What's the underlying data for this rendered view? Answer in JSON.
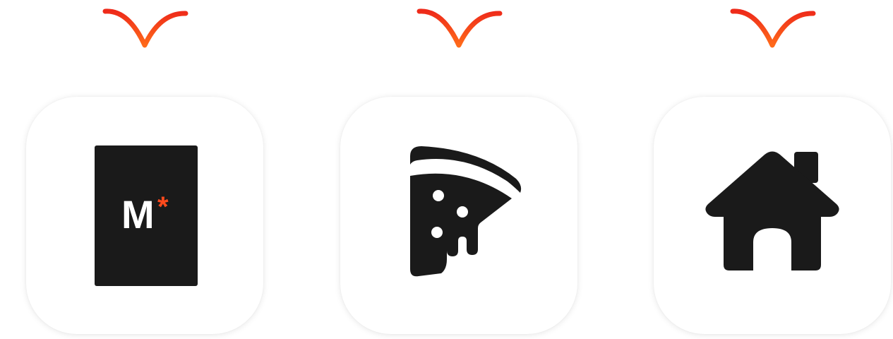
{
  "colors": {
    "accent": "#ff4a1c",
    "icon_dark": "#1a1a1a",
    "card_bg": "#ffffff"
  },
  "items": [
    {
      "id": "menu",
      "icon": "menu-book-icon",
      "logo_letter": "M",
      "logo_mark": "*"
    },
    {
      "id": "food",
      "icon": "pizza-slice-icon"
    },
    {
      "id": "home",
      "icon": "house-icon"
    }
  ]
}
